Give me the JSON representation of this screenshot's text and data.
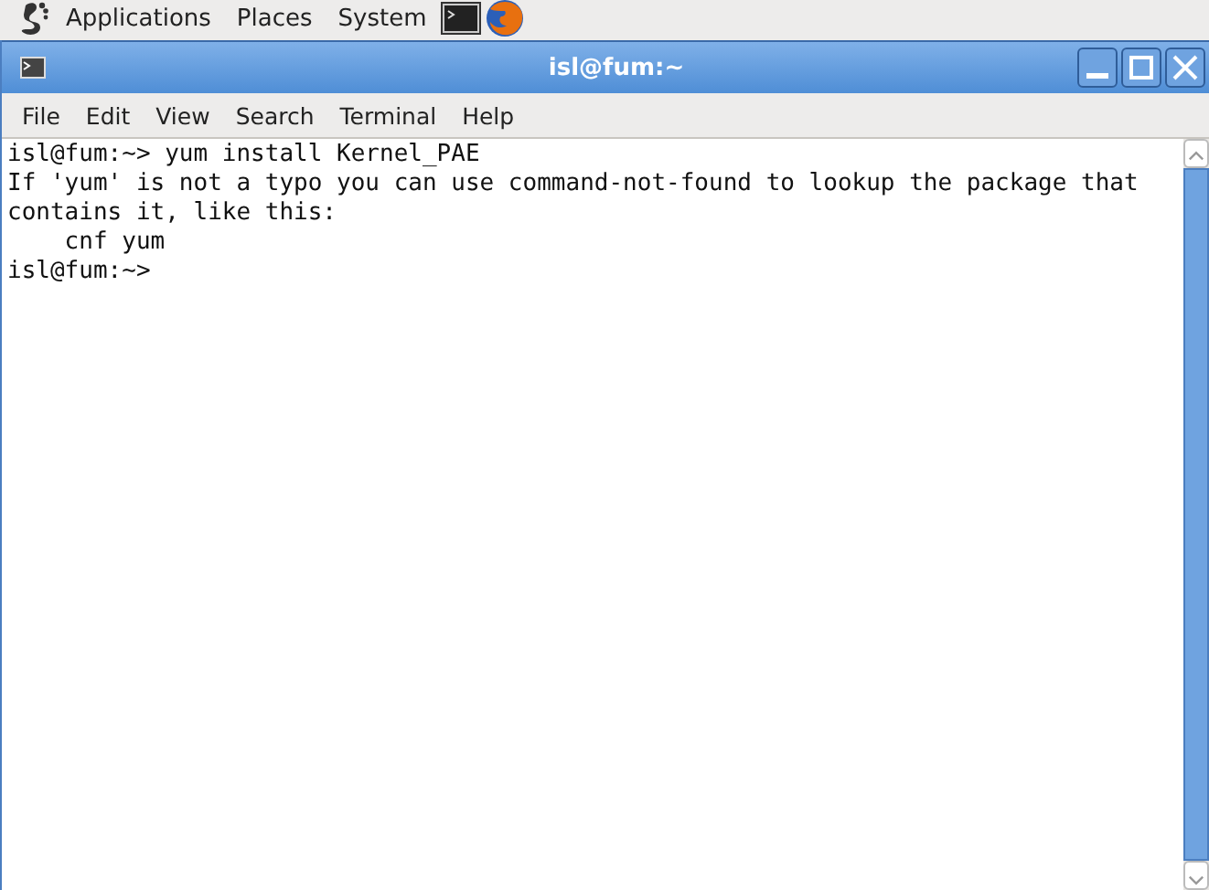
{
  "top_panel": {
    "menus": [
      "Applications",
      "Places",
      "System"
    ]
  },
  "window": {
    "title": "isl@fum:~"
  },
  "menubar": [
    "File",
    "Edit",
    "View",
    "Search",
    "Terminal",
    "Help"
  ],
  "terminal": {
    "lines": [
      "isl@fum:~> yum install Kernel_PAE",
      "If 'yum' is not a typo you can use command-not-found to lookup the package that",
      "contains it, like this:",
      "    cnf yum",
      "isl@fum:~>"
    ]
  }
}
